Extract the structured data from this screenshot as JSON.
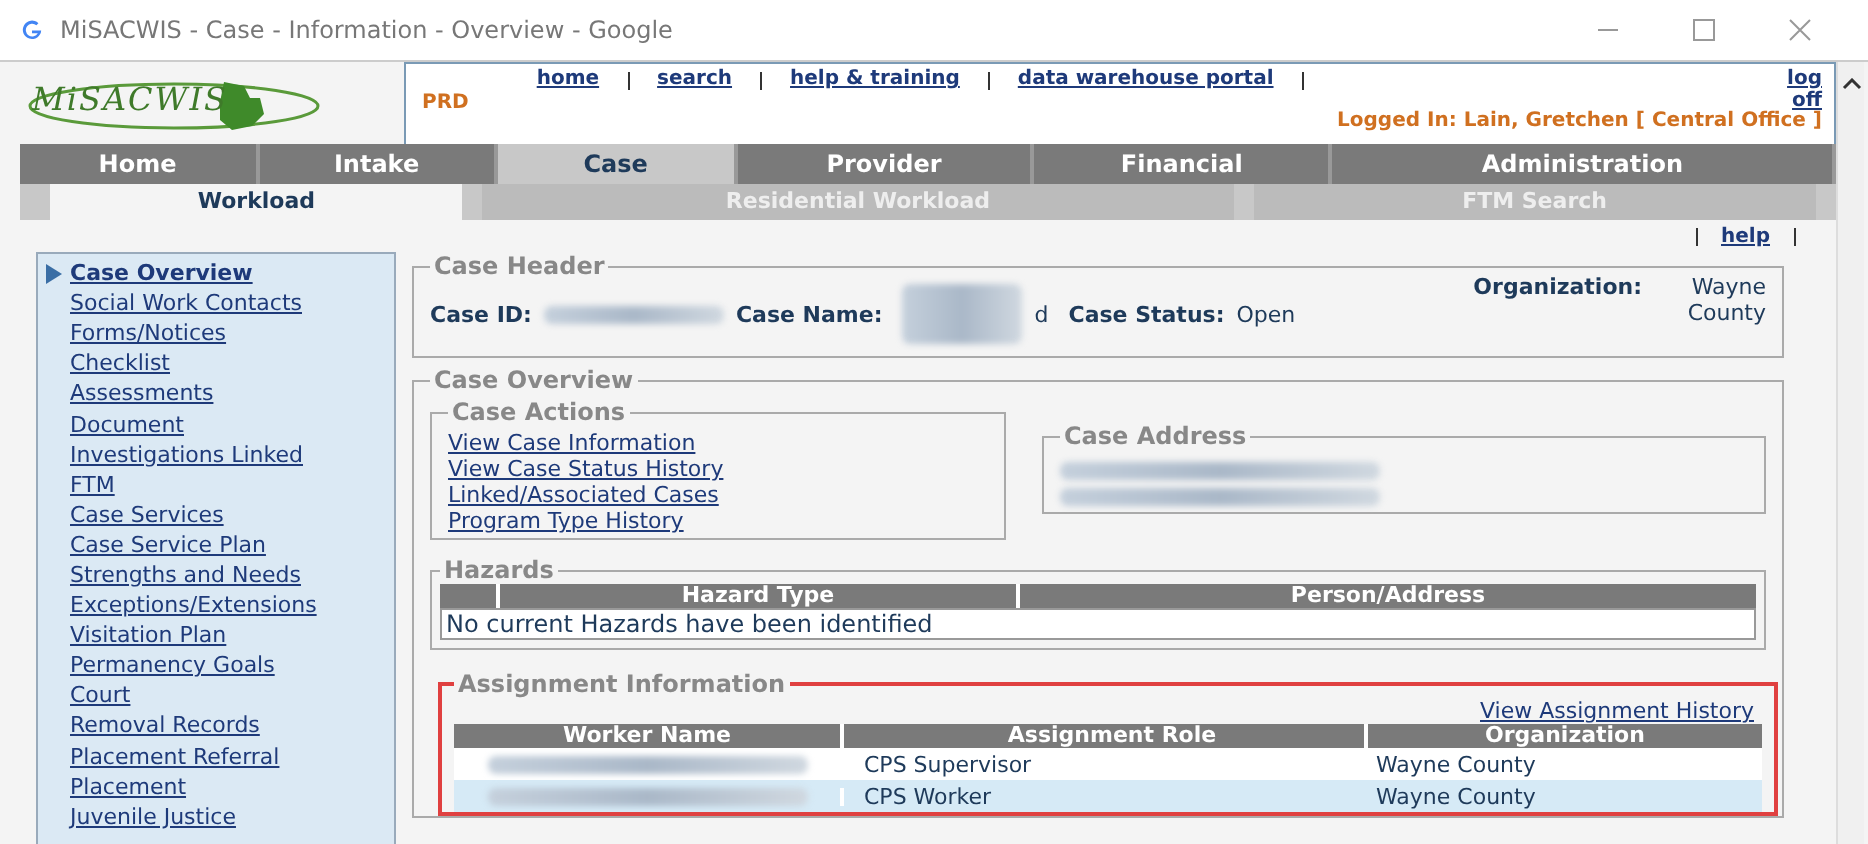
{
  "window": {
    "title": "MiSACWIS - Case - Information - Overview - Google"
  },
  "header": {
    "logo": "MiSACWIS",
    "environment": "PRD",
    "links": [
      "home",
      "search",
      "help & training",
      "data warehouse portal",
      "log off"
    ],
    "logged_in": "Logged In:  Lain, Gretchen [ Central Office ]"
  },
  "tabs": [
    {
      "label": "Home",
      "selected": false
    },
    {
      "label": "Intake",
      "selected": false
    },
    {
      "label": "Case",
      "selected": true
    },
    {
      "label": "Provider",
      "selected": false
    },
    {
      "label": "Financial",
      "selected": false
    },
    {
      "label": "Administration",
      "selected": false
    }
  ],
  "subtabs": [
    {
      "label": "Workload",
      "selected": true
    },
    {
      "label": "Residential Workload",
      "selected": false
    },
    {
      "label": "FTM Search",
      "selected": false
    }
  ],
  "help_link": "help",
  "sidebar": {
    "items": [
      {
        "label": "Case Overview",
        "selected": true
      },
      {
        "label": "Social Work Contacts",
        "selected": false
      },
      {
        "label": "Forms/Notices",
        "selected": false
      },
      {
        "label": "Checklist",
        "selected": false
      },
      {
        "label": "Assessments",
        "selected": false
      },
      {
        "label": "Document",
        "selected": false
      },
      {
        "label": "Investigations Linked",
        "selected": false
      },
      {
        "label": "FTM",
        "selected": false
      },
      {
        "label": "Case Services",
        "selected": false
      },
      {
        "label": "Case Service Plan",
        "selected": false
      },
      {
        "label": "Strengths and Needs",
        "selected": false
      },
      {
        "label": "Exceptions/Extensions",
        "selected": false
      },
      {
        "label": "Visitation Plan",
        "selected": false
      },
      {
        "label": "Permanency Goals",
        "selected": false
      },
      {
        "label": "Court",
        "selected": false
      },
      {
        "label": "Removal Records",
        "selected": false
      },
      {
        "label": "Placement Referral",
        "selected": false
      },
      {
        "label": "Placement",
        "selected": false
      },
      {
        "label": "Juvenile Justice",
        "selected": false
      }
    ]
  },
  "case_header": {
    "title": "Case Header",
    "case_id_label": "Case ID:",
    "case_name_label": "Case Name:",
    "case_name_tail": "d",
    "case_status_label": "Case Status:",
    "case_status": "Open",
    "organization_label": "Organization:",
    "organization": "Wayne County"
  },
  "case_overview": {
    "title": "Case Overview",
    "actions_title": "Case Actions",
    "actions": [
      "View Case Information",
      "View Case Status History",
      "Linked/Associated Cases",
      "Program Type History"
    ],
    "address_title": "Case Address"
  },
  "hazards": {
    "title": "Hazards",
    "columns": [
      "Hazard Type",
      "Person/Address"
    ],
    "empty_message": "No current Hazards have been identified"
  },
  "assignment": {
    "title": "Assignment Information",
    "history_link": "View Assignment History",
    "columns": [
      "Worker Name",
      "Assignment Role",
      "Organization"
    ],
    "rows": [
      {
        "role": "CPS Supervisor",
        "organization": "Wayne County",
        "selected": false
      },
      {
        "role": "CPS Worker",
        "organization": "Wayne County",
        "selected": true
      }
    ]
  }
}
